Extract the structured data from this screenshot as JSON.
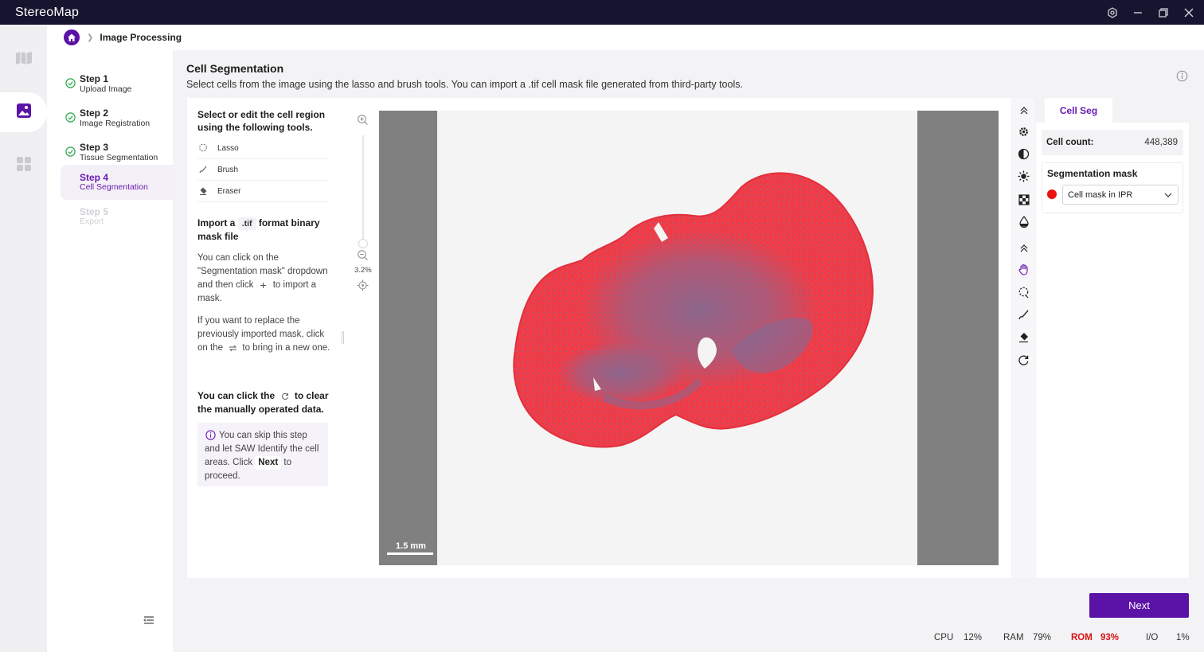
{
  "app": {
    "title": "StereoMap"
  },
  "breadcrumb": {
    "current": "Image Processing"
  },
  "steps": [
    {
      "title": "Step 1",
      "subtitle": "Upload Image",
      "state": "done"
    },
    {
      "title": "Step 2",
      "subtitle": "Image Registration",
      "state": "done"
    },
    {
      "title": "Step 3",
      "subtitle": "Tissue Segmentation",
      "state": "done"
    },
    {
      "title": "Step 4",
      "subtitle": "Cell Segmentation",
      "state": "active"
    },
    {
      "title": "Step 5",
      "subtitle": "Export",
      "state": "disabled"
    }
  ],
  "header": {
    "title": "Cell Segmentation",
    "description": "Select cells from the image using the lasso and brush tools. You can import a .tif cell mask file generated from third-party tools."
  },
  "instructions": {
    "heading1": "Select or edit the cell region using the following tools.",
    "tools": [
      {
        "label": "Lasso",
        "icon": "lasso-icon"
      },
      {
        "label": "Brush",
        "icon": "brush-icon"
      },
      {
        "label": "Eraser",
        "icon": "eraser-icon"
      }
    ],
    "import_pre": "Import a",
    "import_code": ".tif",
    "import_post": "format binary mask file",
    "para1_a": "You can click on the \"Segmentation mask\" dropdown and then click",
    "para1_b": "to import a mask.",
    "para2_a": "If you want to replace the previously imported mask, click on the",
    "para2_b": "to bring in a new one.",
    "clear_a": "You can click the",
    "clear_b": "to clear the manually operated data.",
    "tip_a": "You can skip this step and let SAW Identify the cell areas. Click",
    "tip_next": "Next",
    "tip_b": "to proceed."
  },
  "viewer": {
    "zoom_label": "3.2%",
    "scale_label": "1.5 mm"
  },
  "right_panel": {
    "tab": "Cell Seg",
    "cell_count_label": "Cell count:",
    "cell_count_value": "448,389",
    "seg_mask_title": "Segmentation mask",
    "seg_mask_selected": "Cell mask in IPR",
    "mask_color": "#ee1111"
  },
  "actions": {
    "next_label": "Next"
  },
  "status": {
    "cpu_label": "CPU",
    "cpu_value": "12%",
    "ram_label": "RAM",
    "ram_value": "79%",
    "rom_label": "ROM",
    "rom_value": "93%",
    "io_label": "I/O",
    "io_value": "1%"
  },
  "colors": {
    "accent": "#5a13a6",
    "titlebar": "#16142e"
  }
}
